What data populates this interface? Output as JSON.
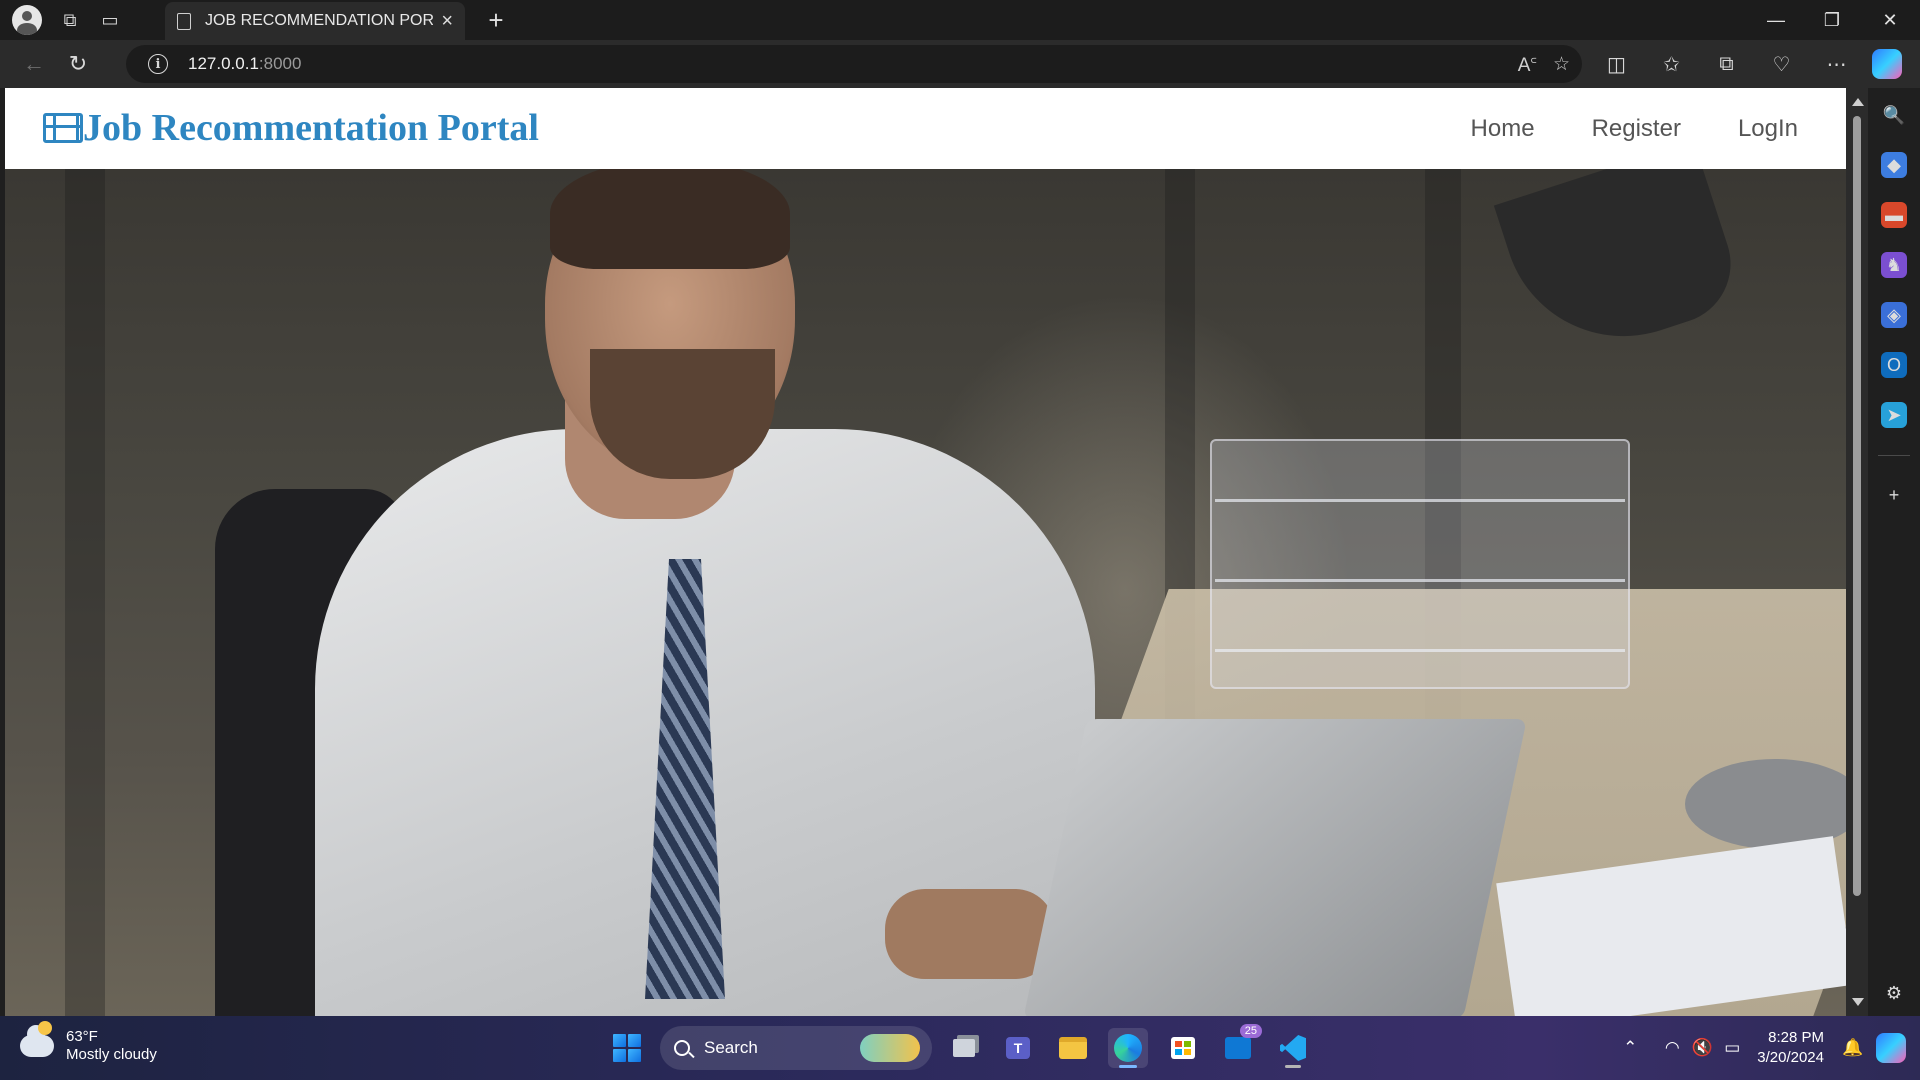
{
  "browser": {
    "tab_title": "JOB RECOMMENDATION PORTAL",
    "url_host": "127.0.0.1",
    "url_port": ":8000",
    "window_controls": {
      "minimize": "—",
      "maximize": "❐",
      "close": "✕"
    }
  },
  "site": {
    "brand": "Job Recommentation Portal",
    "nav": [
      {
        "label": "Home"
      },
      {
        "label": "Register"
      },
      {
        "label": "LogIn"
      }
    ],
    "brand_color": "#2e86c1",
    "nav_color": "#555555"
  },
  "hero": {
    "image_subject": "man in white shirt and striped tie working on laptop at office desk at night"
  },
  "taskbar": {
    "weather_temp": "63°F",
    "weather_desc": "Mostly cloudy",
    "search_placeholder": "Search",
    "mail_badge": "25",
    "time": "8:28 PM",
    "date": "3/20/2024"
  }
}
